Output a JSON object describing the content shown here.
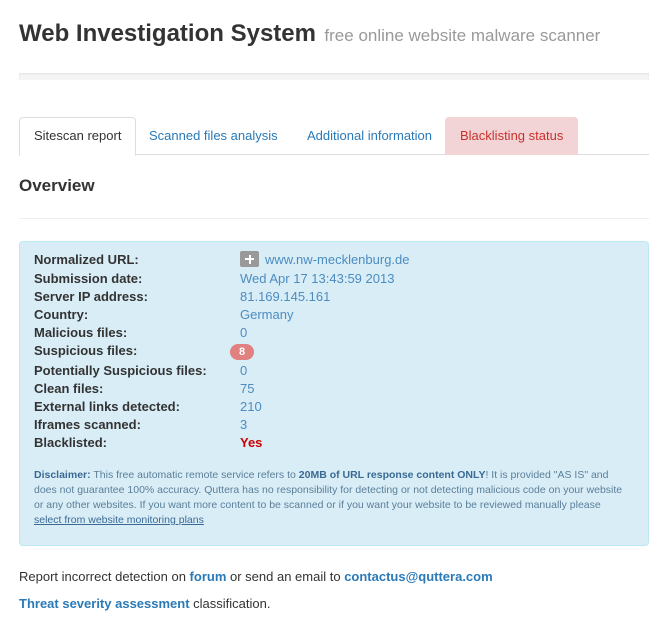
{
  "header": {
    "title": "Web Investigation System",
    "subtitle": "free online website malware scanner"
  },
  "tabs": [
    {
      "label": "Sitescan report",
      "state": "active"
    },
    {
      "label": "Scanned files analysis",
      "state": "normal"
    },
    {
      "label": "Additional information",
      "state": "normal"
    },
    {
      "label": "Blacklisting status",
      "state": "alert"
    }
  ],
  "overview": {
    "title": "Overview"
  },
  "report": {
    "normalized_url_label": "Normalized URL:",
    "normalized_url": "www.nw-mecklenburg.de",
    "submission_date_label": "Submission date:",
    "submission_date": "Wed Apr 17 13:43:59 2013",
    "server_ip_label": "Server IP address:",
    "server_ip": "81.169.145.161",
    "country_label": "Country:",
    "country": "Germany",
    "malicious_label": "Malicious files:",
    "malicious": "0",
    "suspicious_label": "Suspicious files:",
    "suspicious": "8",
    "potentially_suspicious_label": "Potentially Suspicious files:",
    "potentially_suspicious": "0",
    "clean_label": "Clean files:",
    "clean": "75",
    "external_links_label": "External links detected:",
    "external_links": "210",
    "iframes_label": "Iframes scanned:",
    "iframes": "3",
    "blacklisted_label": "Blacklisted:",
    "blacklisted": "Yes"
  },
  "disclaimer": {
    "label": "Disclaimer:",
    "text_1": " This free automatic remote service refers to ",
    "bold_1": "20MB of URL response content ONLY",
    "text_2": "! It is provided \"AS IS\" and does not guarantee 100% accuracy. Quttera has no responsibility for detecting or not detecting malicious code on your website or any other websites. If you want more content to be scanned or if you want your website to be reviewed manually please ",
    "link": "select from website monitoring plans"
  },
  "footer": {
    "line1_prefix": "Report incorrect detection on ",
    "forum_link": "forum",
    "line1_middle": " or send an email to ",
    "email_link": "contactus@quttera.com",
    "threat_link": "Threat severity assessment",
    "line2_suffix": " classification."
  },
  "colors": {
    "link": "#2a7ab8",
    "info_bg": "#d9edf7",
    "alert_tab_bg": "#f2d4d6",
    "danger": "#cc0000",
    "badge": "#e08080"
  },
  "icons": [
    "plus-icon"
  ]
}
